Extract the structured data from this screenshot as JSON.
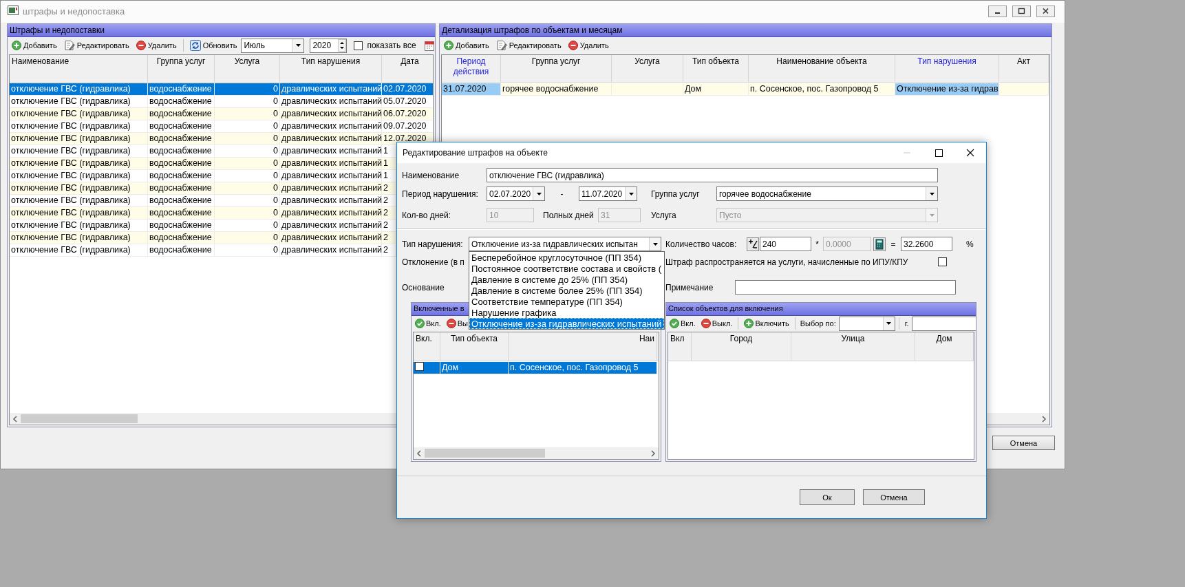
{
  "main_window": {
    "title": "штрафы и недопоставка"
  },
  "left_panel": {
    "title": "Штрафы и недопоставки",
    "toolbar": {
      "buttons": [
        {
          "kind": "add",
          "label": "Добавить"
        },
        {
          "kind": "edit",
          "label": "Редактировать"
        },
        {
          "kind": "delete",
          "label": "Удалить"
        },
        {
          "kind": "refresh",
          "label": "Обновить"
        }
      ],
      "month": "Июль",
      "year": "2020",
      "show_all": {
        "label": "показать все",
        "checked": false
      }
    },
    "table": {
      "columns": [
        "Наименование",
        "Группа услуг",
        "Услуга",
        "Тип нарушения",
        "Дата"
      ],
      "rows": [
        {
          "cells": [
            "отключение ГВС (гидравлика)",
            "водоснабжение",
            "0",
            "дравлических испытаний",
            "02.07.2020"
          ],
          "selected": true
        },
        {
          "cells": [
            "отключение ГВС (гидравлика)",
            "водоснабжение",
            "0",
            "дравлических испытаний",
            "05.07.2020"
          ],
          "selected": false
        },
        {
          "cells": [
            "отключение ГВС (гидравлика)",
            "водоснабжение",
            "0",
            "дравлических испытаний",
            "06.07.2020"
          ],
          "selected": false
        },
        {
          "cells": [
            "отключение ГВС (гидравлика)",
            "водоснабжение",
            "0",
            "дравлических испытаний",
            "09.07.2020"
          ],
          "selected": false
        },
        {
          "cells": [
            "отключение ГВС (гидравлика)",
            "водоснабжение",
            "0",
            "дравлических испытаний",
            "12.07.2020"
          ],
          "selected": false
        },
        {
          "cells": [
            "отключение ГВС (гидравлика)",
            "водоснабжение",
            "0",
            "дравлических испытаний",
            "1"
          ],
          "selected": false
        },
        {
          "cells": [
            "отключение ГВС (гидравлика)",
            "водоснабжение",
            "0",
            "дравлических испытаний",
            "1"
          ],
          "selected": false
        },
        {
          "cells": [
            "отключение ГВС (гидравлика)",
            "водоснабжение",
            "0",
            "дравлических испытаний",
            "1"
          ],
          "selected": false
        },
        {
          "cells": [
            "отключение ГВС (гидравлика)",
            "водоснабжение",
            "0",
            "дравлических испытаний",
            "2"
          ],
          "selected": false
        },
        {
          "cells": [
            "отключение ГВС (гидравлика)",
            "водоснабжение",
            "0",
            "дравлических испытаний",
            "2"
          ],
          "selected": false
        },
        {
          "cells": [
            "отключение ГВС (гидравлика)",
            "водоснабжение",
            "0",
            "дравлических испытаний",
            "2"
          ],
          "selected": false
        },
        {
          "cells": [
            "отключение ГВС (гидравлика)",
            "водоснабжение",
            "0",
            "дравлических испытаний",
            "2"
          ],
          "selected": false
        },
        {
          "cells": [
            "отключение ГВС (гидравлика)",
            "водоснабжение",
            "0",
            "дравлических испытаний",
            "2"
          ],
          "selected": false
        },
        {
          "cells": [
            "отключение ГВС (гидравлика)",
            "водоснабжение",
            "0",
            "дравлических испытаний",
            "2"
          ],
          "selected": false
        }
      ]
    }
  },
  "right_panel": {
    "title": "Детализация штрафов по объектам и месяцам",
    "toolbar": {
      "buttons": [
        {
          "kind": "add",
          "label": "Добавить"
        },
        {
          "kind": "edit",
          "label": "Редактировать"
        },
        {
          "kind": "delete",
          "label": "Удалить"
        }
      ]
    },
    "table": {
      "columns": [
        {
          "label": "Период действия",
          "highlighted": true
        },
        {
          "label": "Группа услуг",
          "highlighted": false
        },
        {
          "label": "Услуга",
          "highlighted": false
        },
        {
          "label": "Тип объекта",
          "highlighted": false
        },
        {
          "label": "Наименование объекта",
          "highlighted": false
        },
        {
          "label": "Тип нарушения",
          "highlighted": true
        },
        {
          "label": "Акт",
          "highlighted": false
        }
      ],
      "rows": [
        {
          "cells": [
            {
              "text": "31.07.2020",
              "highlighted": true
            },
            {
              "text": "горячее водоснабжение",
              "highlighted": false
            },
            {
              "highlighted": false
            },
            {
              "text": "Дом",
              "highlighted": false
            },
            {
              "text": "п. Сосенское, пос. Газопровод 5",
              "highlighted": false
            },
            {
              "text": "Отключение из-за гидрав",
              "highlighted": true
            },
            {
              "highlighted": false
            }
          ]
        }
      ]
    }
  },
  "main_buttons": [
    {
      "label": "Отмена"
    }
  ],
  "dialog": {
    "title": "Редактирование штрафов на объекте",
    "name": {
      "label": "Наименование",
      "value": "отключение ГВС (гидравлика)"
    },
    "period": {
      "label": "Период нарушения:",
      "from": "02.07.2020",
      "separator": "-",
      "to": "11.07.2020"
    },
    "service_group": {
      "label": "Группа услуг",
      "value": "горячее водоснабжение"
    },
    "days": {
      "label": "Кол-во дней:",
      "value": "10",
      "disabled": true
    },
    "full_days": {
      "label": "Полных дней",
      "value": "31",
      "disabled": true
    },
    "service": {
      "label": "Услуга",
      "value": "Пусто",
      "disabled": true
    },
    "violation_type": {
      "label": "Тип нарушения:",
      "value": "Отключение из-за гидравлических испытан",
      "expanded": true,
      "options": [
        {
          "label": "Бесперебойное круглосуточное (ПП 354)",
          "selected": false
        },
        {
          "label": "Постоянное соответствие состава и свойств (",
          "selected": false
        },
        {
          "label": "Давление в системе  до 25% (ПП 354)",
          "selected": false
        },
        {
          "label": "Давление в системе более 25% (ПП 354)",
          "selected": false
        },
        {
          "label": "Соответствие температуре (ПП 354)",
          "selected": false
        },
        {
          "label": "Нарушение графика",
          "selected": false
        },
        {
          "label": "Отключение из-за гидравлических испытаний",
          "selected": true
        }
      ]
    },
    "hours": {
      "label": "Количество часов:",
      "value": "240",
      "multiply_sign": "*",
      "factor": {
        "value": "0.0000",
        "disabled": true
      },
      "equals_sign": "=",
      "result": "32.2600",
      "unit": "%"
    },
    "deviation": {
      "label": "Отклонение (в п"
    },
    "ipu_kpu": {
      "label": "Штраф распространяется на услуги, начисленные по ИПУ/КПУ",
      "checked": false
    },
    "basis": {
      "label": "Основание"
    },
    "note": {
      "label": "Примечание"
    },
    "included_panel": {
      "title": "Включенные в",
      "toolbar": [
        {
          "kind": "on",
          "label": "Вкл."
        },
        {
          "kind": "off",
          "label": "Вы"
        }
      ],
      "table": {
        "columns": [
          "Вкл.",
          "Тип объекта",
          "Наи"
        ],
        "rows": [
          {
            "checked": false,
            "selected": true,
            "cells": [
              "Дом",
              "п. Сосенское, пос. Газопровод 5"
            ]
          }
        ]
      }
    },
    "objects_panel": {
      "title": "Список объектов для включения",
      "toolbar": [
        {
          "kind": "on",
          "label": "Вкл."
        },
        {
          "kind": "off",
          "label": "Выкл."
        },
        {
          "kind": "add",
          "label": "Включить"
        }
      ],
      "filter_label": "Выбор по:",
      "city_label": "г.",
      "table": {
        "columns": [
          "Вкл",
          "Город",
          "Улица",
          "Дом"
        ]
      }
    },
    "buttons": [
      {
        "label": "Ок"
      },
      {
        "label": "Отмена"
      }
    ]
  }
}
